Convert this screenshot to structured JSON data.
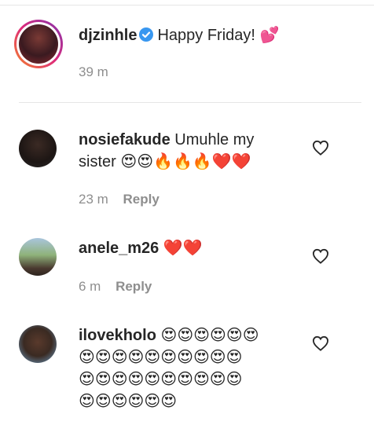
{
  "post": {
    "username": "djzinhle",
    "caption": "Happy Friday!",
    "caption_emoji": "💕",
    "time": "39 m",
    "verified": true
  },
  "comments": [
    {
      "username": "nosiefakude",
      "text_line1": "Umuhle my",
      "text_line2_prefix": "sister",
      "emojis": "😍😍🔥🔥🔥❤️❤️",
      "time": "23 m",
      "reply": "Reply"
    },
    {
      "username": "anele_m26",
      "emojis": "❤️❤️",
      "time": "6 m",
      "reply": "Reply"
    },
    {
      "username": "ilovekholo",
      "emojis_line1": "😍😍😍😍😍😍",
      "emojis_line2": "😍😍😍😍😍😍😍😍😍😍",
      "emojis_line3": "😍😍😍😍😍😍😍😍😍😍",
      "emojis_line4": "😍😍😍😍😍😍"
    }
  ],
  "colors": {
    "story_ring_start": "#f58529",
    "story_ring_end": "#dd2a7b",
    "verified_blue": "#3897f0",
    "meta_gray": "#8e8e8e"
  }
}
